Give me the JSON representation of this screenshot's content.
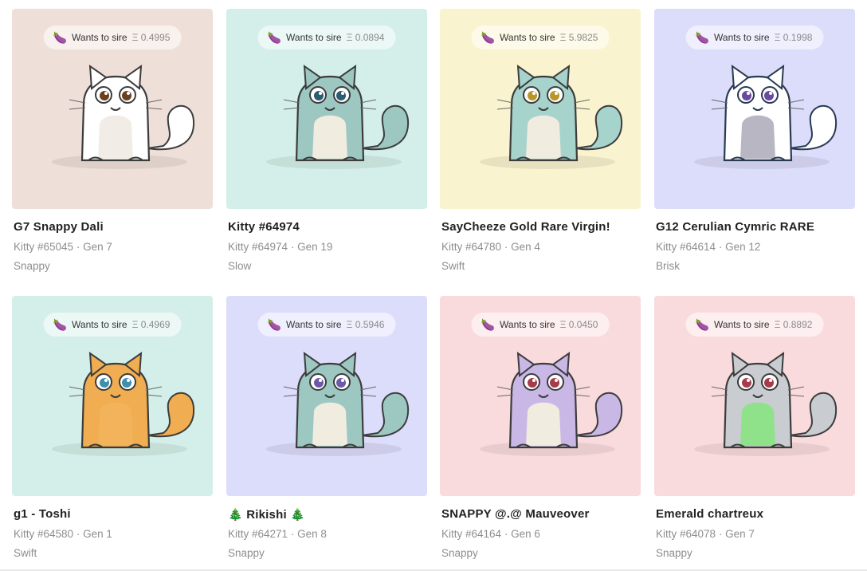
{
  "sire_label": "Wants to sire",
  "kitties": [
    {
      "name": "G7 Snappy Dali",
      "id": "Kitty #65045",
      "gen": "Gen 7",
      "cooldown": "Snappy",
      "price": "Ξ 0.4995",
      "bg": "#efdfd9",
      "body": "#ffffff",
      "belly": "#f1ece6",
      "stroke": "#3c3c3c",
      "eye": "#6b3f1e"
    },
    {
      "name": "Kitty #64974",
      "id": "Kitty #64974",
      "gen": "Gen 19",
      "cooldown": "Slow",
      "price": "Ξ 0.0894",
      "bg": "#d4efe9",
      "body": "#9dc8c2",
      "belly": "#f1ece0",
      "stroke": "#3c3c3c",
      "eye": "#2b5c72"
    },
    {
      "name": "SayCheeze Gold Rare Virgin!",
      "id": "Kitty #64780",
      "gen": "Gen 4",
      "cooldown": "Swift",
      "price": "Ξ 5.9825",
      "bg": "#faf3cf",
      "body": "#a6d3cc",
      "belly": "#f1ece0",
      "stroke": "#3c3c3c",
      "eye": "#b8972a"
    },
    {
      "name": "G12 Cerulian Cymric RARE",
      "id": "Kitty #64614",
      "gen": "Gen 12",
      "cooldown": "Brisk",
      "price": "Ξ 0.1998",
      "bg": "#dcdcfb",
      "body": "#ffffff",
      "belly": "#b9b6c3",
      "stroke": "#2a3a52",
      "eye": "#6a4aa0"
    },
    {
      "name": "g1 - Toshi",
      "id": "Kitty #64580",
      "gen": "Gen 1",
      "cooldown": "Swift",
      "price": "Ξ 0.4969",
      "bg": "#d4efe9",
      "body": "#f1ad52",
      "belly": "#f3b35b",
      "stroke": "#3c3c3c",
      "eye": "#3f8fa8"
    },
    {
      "name": "🎄 Rikishi 🎄",
      "id": "Kitty #64271",
      "gen": "Gen 8",
      "cooldown": "Snappy",
      "price": "Ξ 0.5946",
      "bg": "#dcdcfb",
      "body": "#9dc8c2",
      "belly": "#f1ece0",
      "stroke": "#3c3c3c",
      "eye": "#6b5aa5"
    },
    {
      "name": "SNAPPY @.@ Mauveover",
      "id": "Kitty #64164",
      "gen": "Gen 6",
      "cooldown": "Snappy",
      "price": "Ξ 0.0450",
      "bg": "#fadbdd",
      "body": "#c9b8e6",
      "belly": "#f1ece0",
      "stroke": "#3c3c3c",
      "eye": "#a43c4b"
    },
    {
      "name": "Emerald chartreux",
      "id": "Kitty #64078",
      "gen": "Gen 7",
      "cooldown": "Snappy",
      "price": "Ξ 0.8892",
      "bg": "#fadbdd",
      "body": "#c9ccd0",
      "belly": "#8fe28a",
      "stroke": "#3c3c3c",
      "eye": "#a43c4b"
    }
  ]
}
